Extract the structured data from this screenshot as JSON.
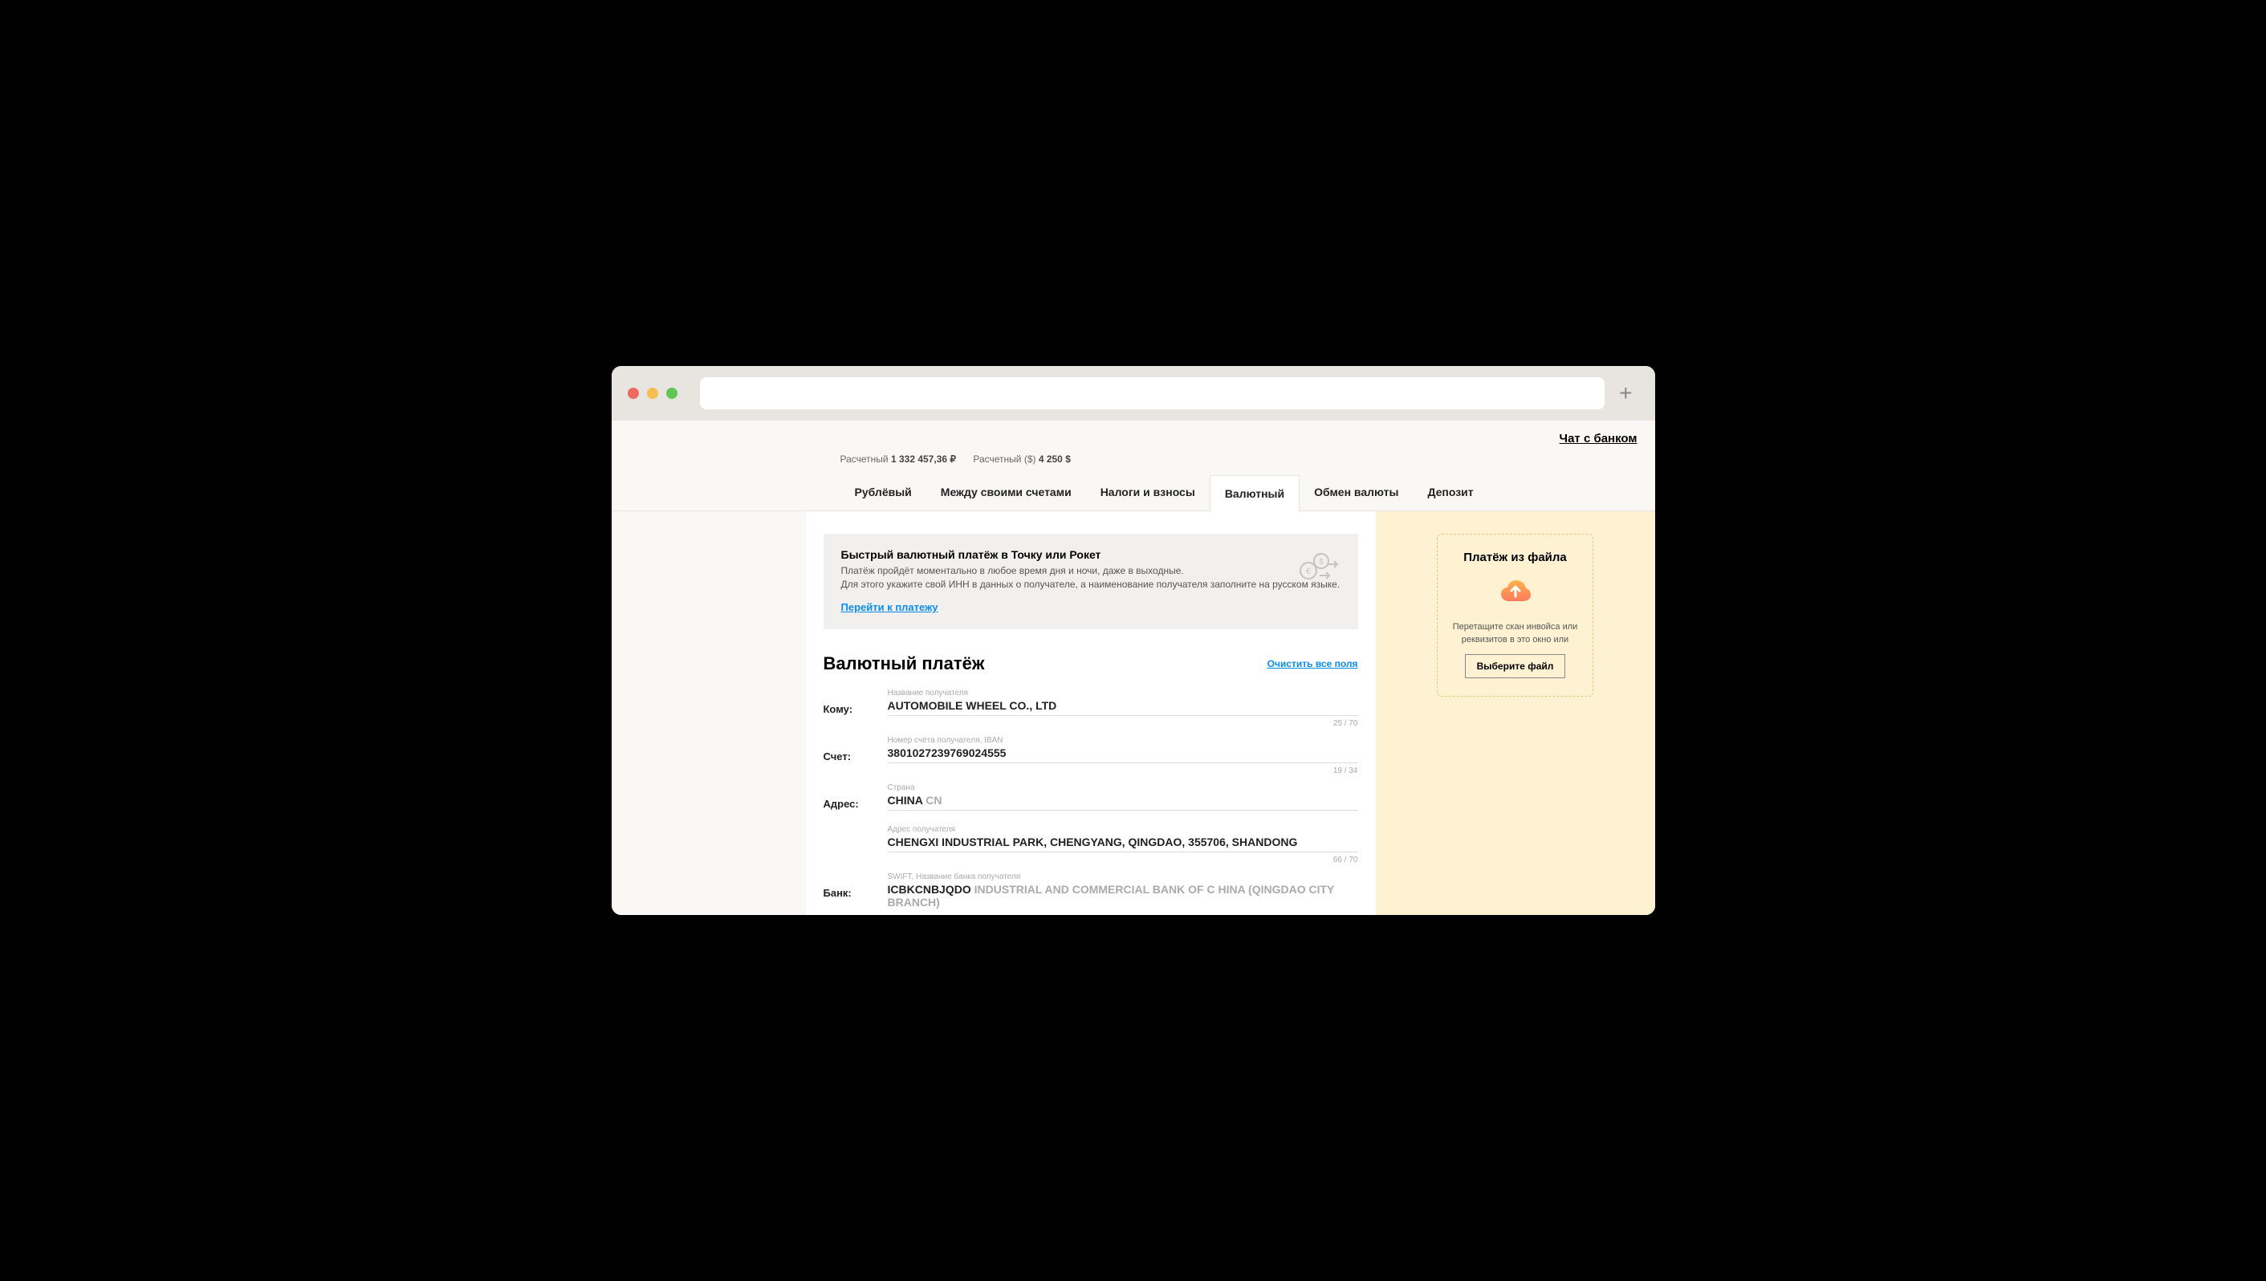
{
  "header": {
    "chat_link": "Чат с банком"
  },
  "accounts": {
    "rub_label": "Расчетный",
    "rub_value": "1 332 457,36 ₽",
    "usd_label": "Расчетный ($)",
    "usd_value": "4 250 $"
  },
  "tabs": {
    "rub": "Рублёвый",
    "between": "Между своими счетами",
    "taxes": "Налоги и взносы",
    "currency": "Валютный",
    "exchange": "Обмен валюты",
    "deposit": "Депозит"
  },
  "info": {
    "title": "Быстрый валютный платёж в Точку или Рокет",
    "line1": "Платёж пройдёт моментально в любое время дня и ночи, даже в выходные.",
    "line2": "Для этого укажите свой ИНН в данных о получателе, а наименование получателя заполните на русском языке.",
    "link": "Перейти к платежу"
  },
  "form": {
    "title": "Валютный платёж",
    "clear": "Очистить все поля",
    "to": {
      "label": "Кому:",
      "sublabel": "Название получателя",
      "value": "AUTOMOBILE WHEEL CO., LTD",
      "counter": "25 / 70"
    },
    "account": {
      "label": "Счет:",
      "sublabel": "Номер счёта получателя, IBAN",
      "value": "3801027239769024555",
      "counter": "19 / 34"
    },
    "address": {
      "label": "Адрес:",
      "sublabel_country": "Страна",
      "country": "CHINA",
      "country_code": "CN",
      "sublabel_addr": "Адрес получателя",
      "addr": "CHENGXI INDUSTRIAL PARK, CHENGYANG, QINGDAO, 355706, SHANDONG",
      "counter": "66 / 70"
    },
    "bank": {
      "label": "Банк:",
      "sublabel": "SWIFT, Название банка получателя",
      "swift": "ICBKCNBJQDO",
      "name": "INDUSTRIAL AND COMMERCIAL BANK OF C HINA (QINGDAO CITY BRANCH)"
    }
  },
  "upload": {
    "title": "Платёж из файла",
    "text": "Перетащите скан инвойса или реквизитов в это окно или",
    "button": "Выберите файл"
  }
}
